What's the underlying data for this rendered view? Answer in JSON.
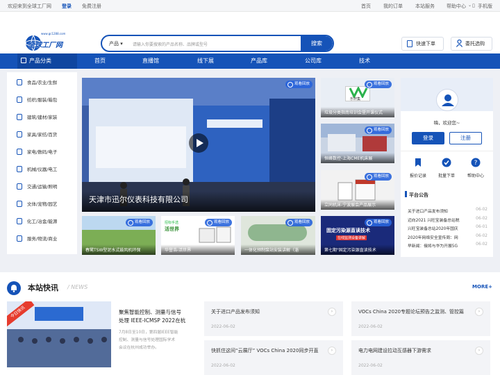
{
  "topbar": {
    "welcome": "欢迎来到全球工厂网",
    "login": "登录",
    "register": "免费注册",
    "home": "首页",
    "orders": "我的订单",
    "service": "本站服务",
    "help": "帮助中心",
    "mobile": "手机版"
  },
  "header": {
    "logo_text": "全球工厂网",
    "logo_url": "www.gc1288.com",
    "search_cat": "产品",
    "search_placeholder": "请输入你要搜索的产品名称、品牌或型号",
    "search_btn": "搜索",
    "quick_order": "快速下单",
    "entrust": "委托选购"
  },
  "nav": {
    "category": "产品分类",
    "items": [
      "首页",
      "直播馆",
      "线下展",
      "产品库",
      "公司库",
      "技术"
    ]
  },
  "sidebar": {
    "items": [
      "食品/农业/生鲜",
      "纺织/服装/箱包",
      "建筑/建材/家装",
      "家具/家纺/百货",
      "家电/数码/电子",
      "机械/仪器/电工",
      "交通/运输/照明",
      "文体/宠物/园艺",
      "化工/冶金/能源",
      "服务/物流/商业"
    ]
  },
  "video": {
    "title": "天津市迅尔仪表科技有限公司",
    "badge": "观看回放"
  },
  "thumbs": [
    {
      "cap": "垃圾分类指南培训会暨开课仪式",
      "badge": "观看回放"
    },
    {
      "cap": "恒峰数控-上海CME机床展",
      "badge": "观看回放"
    },
    {
      "cap": "立同机床-宁波展会产品展示",
      "badge": "观看回放"
    },
    {
      "cap": "春鹭TSW型泥水式鼓风机环保",
      "badge": "观看回放"
    },
    {
      "cap": "华誉浩-活世界",
      "badge": "观看回放"
    },
    {
      "cap": "一体化预制泵站安装讲解（淄",
      "badge": "观看回放"
    },
    {
      "cap": "第七期\"固定污染源直读技术",
      "badge": "观看回放"
    }
  ],
  "thumb_overlay": {
    "t5_top": "招标手选",
    "t5_brand": "活世界",
    "t7_line1": "固定污染源直读技术",
    "t7_line2": "在线监测设备讲解",
    "t1_logo": "乐轩集"
  },
  "user": {
    "greeting": "嗨，欢迎您~",
    "login": "登录",
    "register": "注册",
    "links": [
      "报价记录",
      "批量下单",
      "帮助中心"
    ],
    "notice_title": "平台公告",
    "notices": [
      {
        "t": "关于进口产品发布须知",
        "d": "06-02"
      },
      {
        "t": "迈向2021 兴旺宝装备总站税",
        "d": "06-02"
      },
      {
        "t": "兴旺宝装备总站2020年国庆",
        "d": "06-01"
      },
      {
        "t": "2020年网络安全宣传周：网",
        "d": "06-02"
      },
      {
        "t": "早新闻：俄将与华为开展5G",
        "d": "06-02"
      }
    ]
  },
  "news": {
    "title": "本站快讯",
    "sub": "/ NEWS",
    "more": "MORE+",
    "img_badge": "今日快讯",
    "feature": {
      "title1": "聚焦智能控制、测量与信号",
      "title2": "处理 IEEE-ICMSP 2022在杭",
      "desc1": "7月8日至10日，第四届IEEE智能",
      "desc2": "控制、测量与信号处理国际学术",
      "desc3": "会议在杭州成功举办。"
    },
    "cards": [
      {
        "t": "关于进口产品发布须知",
        "d": "2022-06-02"
      },
      {
        "t": "VOCs China 2020专题论坛预告之监测、管控篇",
        "d": "2022-06-02"
      },
      {
        "t": "快抓住这间“云展厅” VOCs China 2020同步开直",
        "d": "2022-06-02"
      },
      {
        "t": "电力电网建设拉动互感器下游需求",
        "d": "2022-06-02"
      }
    ]
  },
  "colors": {
    "brand": "#1553b8",
    "accent": "#e63c2e"
  }
}
